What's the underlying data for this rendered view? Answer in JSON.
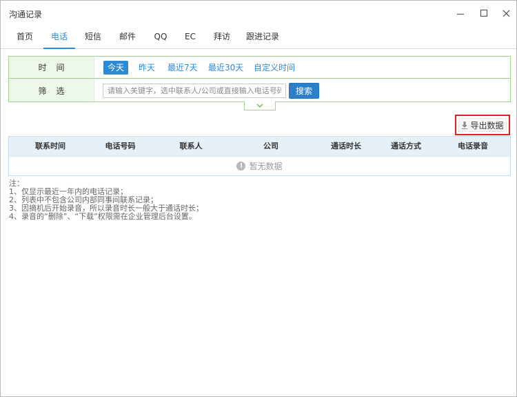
{
  "window": {
    "title": "沟通记录"
  },
  "tabs": [
    {
      "label": "首页",
      "active": false
    },
    {
      "label": "电话",
      "active": true
    },
    {
      "label": "短信",
      "active": false
    },
    {
      "label": "邮件",
      "active": false
    },
    {
      "label": "QQ",
      "active": false
    },
    {
      "label": "EC",
      "active": false
    },
    {
      "label": "拜访",
      "active": false
    },
    {
      "label": "跟进记录",
      "active": false
    }
  ],
  "filter": {
    "time_label": "时间",
    "time_options": [
      {
        "label": "今天",
        "active": true
      },
      {
        "label": "昨天",
        "active": false
      },
      {
        "label": "最近7天",
        "active": false
      },
      {
        "label": "最近30天",
        "active": false
      },
      {
        "label": "自定义时间",
        "active": false
      }
    ],
    "search_label": "筛选",
    "search_placeholder": "请输入关键字，选中联系人/公司或直接输入电话号码",
    "search_value": "",
    "search_button": "搜索"
  },
  "toolbar": {
    "export_label": "导出数据"
  },
  "table": {
    "columns": [
      "联系时间",
      "电话号码",
      "联系人",
      "公司",
      "通话时长",
      "通话方式",
      "电话录音"
    ],
    "empty_text": "暂无数据"
  },
  "notes": {
    "heading": "注：",
    "items": [
      "1、仅显示最近一年内的电话记录；",
      "2、列表中不包含公司内部同事间联系记录；",
      "3、因摘机后开始录音，所以录音时长一般大于通话时长；",
      "4、录音的“删除”、“下载”权限需在企业管理后台设置。"
    ]
  },
  "colors": {
    "accent": "#2e8bd3",
    "filter_border": "#9fd68b",
    "highlight_border": "#e02020"
  }
}
